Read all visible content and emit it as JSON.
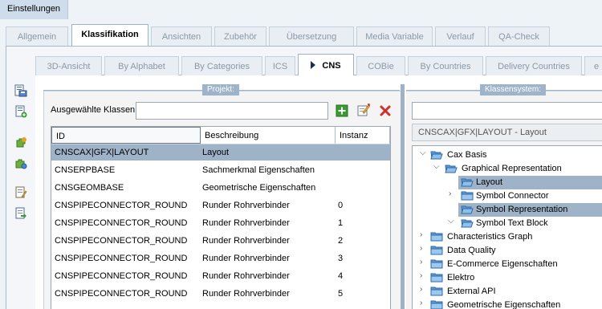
{
  "window": {
    "title": "Einstellungen"
  },
  "main_tabs": [
    {
      "label": "Allgemein",
      "active": false
    },
    {
      "label": "Klassifikation",
      "active": true
    },
    {
      "label": "Ansichten",
      "active": false
    },
    {
      "label": "Zubehör",
      "active": false
    },
    {
      "label": "Übersetzung",
      "active": false
    },
    {
      "label": "Media Variable",
      "active": false
    },
    {
      "label": "Verlauf",
      "active": false
    },
    {
      "label": "QA-Check",
      "active": false
    }
  ],
  "sub_tabs": [
    {
      "label": "3D-Ansicht",
      "active": false
    },
    {
      "label": "By Alphabet",
      "active": false
    },
    {
      "label": "By Categories",
      "active": false
    },
    {
      "label": "ICS",
      "active": false
    },
    {
      "label": "CNS",
      "active": true
    },
    {
      "label": "COBie",
      "active": false
    },
    {
      "label": "By Countries",
      "active": false
    },
    {
      "label": "Delivery Countries",
      "active": false
    },
    {
      "label": "e",
      "active": false
    }
  ],
  "left_panel": {
    "title": "Projekt:",
    "selected_label": "Ausgewählte Klassen",
    "selected_value": "",
    "columns": [
      "ID",
      "Beschreibung",
      "Instanz"
    ],
    "rows": [
      {
        "id": "CNSCAX|GFX|LAYOUT",
        "desc": "Layout",
        "inst": "",
        "selected": true
      },
      {
        "id": "CNSERPBASE",
        "desc": "Sachmerkmal Eigenschaften",
        "inst": "",
        "selected": false
      },
      {
        "id": "CNSGEOMBASE",
        "desc": "Geometrische Eigenschaften",
        "inst": "",
        "selected": false
      },
      {
        "id": "CNSPIPECONNECTOR_ROUND",
        "desc": "Runder Rohrverbinder",
        "inst": "0",
        "selected": false
      },
      {
        "id": "CNSPIPECONNECTOR_ROUND",
        "desc": "Runder Rohrverbinder",
        "inst": "1",
        "selected": false
      },
      {
        "id": "CNSPIPECONNECTOR_ROUND",
        "desc": "Runder Rohrverbinder",
        "inst": "2",
        "selected": false
      },
      {
        "id": "CNSPIPECONNECTOR_ROUND",
        "desc": "Runder Rohrverbinder",
        "inst": "3",
        "selected": false
      },
      {
        "id": "CNSPIPECONNECTOR_ROUND",
        "desc": "Runder Rohrverbinder",
        "inst": "4",
        "selected": false
      },
      {
        "id": "CNSPIPECONNECTOR_ROUND",
        "desc": "Runder Rohrverbinder",
        "inst": "5",
        "selected": false
      }
    ]
  },
  "right_panel": {
    "title": "Klassensystem:",
    "search_value": "",
    "path": "CNSCAX|GFX|LAYOUT - Layout",
    "tree": [
      {
        "label": "Cax Basis",
        "level": 0,
        "expander": "open",
        "folder": "open",
        "selected": false
      },
      {
        "label": "Graphical Representation",
        "level": 1,
        "expander": "open",
        "folder": "open",
        "selected": false
      },
      {
        "label": "Layout",
        "level": 2,
        "expander": "none",
        "folder": "open",
        "selected": true
      },
      {
        "label": "Symbol Connector",
        "level": 2,
        "expander": "closed",
        "folder": "closed",
        "selected": false
      },
      {
        "label": "Symbol Representation",
        "level": 2,
        "expander": "none",
        "folder": "open",
        "selected": true
      },
      {
        "label": "Symbol Text Block",
        "level": 2,
        "expander": "open",
        "folder": "open",
        "selected": false
      },
      {
        "label": "Characteristics Graph",
        "level": 0,
        "expander": "closed",
        "folder": "closed",
        "selected": false
      },
      {
        "label": "Data Quality",
        "level": 0,
        "expander": "closed",
        "folder": "closed",
        "selected": false
      },
      {
        "label": "E-Commerce Eigenschaften",
        "level": 0,
        "expander": "closed",
        "folder": "closed",
        "selected": false
      },
      {
        "label": "Elektro",
        "level": 0,
        "expander": "closed",
        "folder": "closed",
        "selected": false
      },
      {
        "label": "External API",
        "level": 0,
        "expander": "closed",
        "folder": "closed",
        "selected": false
      },
      {
        "label": "Geometrische Eigenschaften",
        "level": 0,
        "expander": "closed",
        "folder": "closed",
        "selected": false
      }
    ]
  },
  "icons": {
    "sidebar": [
      "save-project-icon",
      "new-project-icon",
      "add-plugin-icon",
      "plugin-settings-icon",
      "edit-document-icon",
      "export-document-icon"
    ],
    "toolbar": [
      "add-icon",
      "edit-icon",
      "delete-icon"
    ]
  },
  "colors": {
    "selection": "#9fb3c8",
    "panel_title": "#9eb4ca",
    "add_green": "#3c9a35",
    "delete_red": "#d0302a"
  }
}
